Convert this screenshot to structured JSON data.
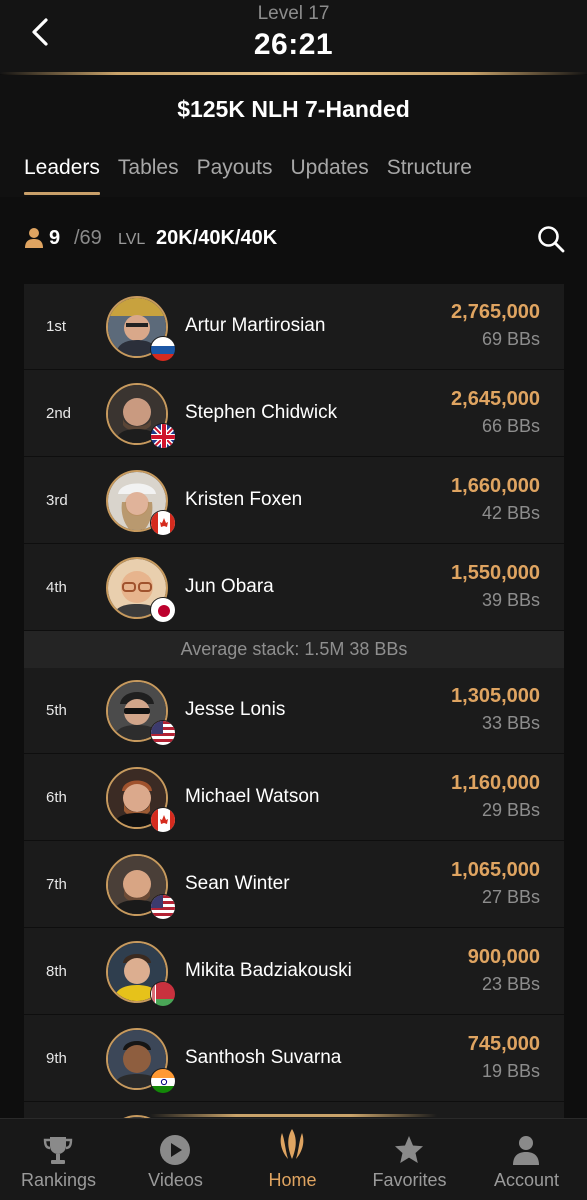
{
  "header": {
    "level_label": "Level 17",
    "clock": "26:21",
    "event_title": "$125K NLH 7-Handed"
  },
  "tabs": [
    {
      "label": "Leaders",
      "active": true
    },
    {
      "label": "Tables",
      "active": false
    },
    {
      "label": "Payouts",
      "active": false
    },
    {
      "label": "Updates",
      "active": false
    },
    {
      "label": "Structure",
      "active": false
    }
  ],
  "stats": {
    "players_left": "9",
    "players_total": "/69",
    "lvl_tag": "LVL",
    "blinds": "20K/40K/40K"
  },
  "leaders": [
    {
      "rank": "1st",
      "name": "Artur Martirosian",
      "chips": "2,765,000",
      "bbs": "69 BBs",
      "flag": "russia-flag-icon"
    },
    {
      "rank": "2nd",
      "name": "Stephen Chidwick",
      "chips": "2,645,000",
      "bbs": "66 BBs",
      "flag": "uk-flag-icon"
    },
    {
      "rank": "3rd",
      "name": "Kristen Foxen",
      "chips": "1,660,000",
      "bbs": "42 BBs",
      "flag": "canada-flag-icon"
    },
    {
      "rank": "4th",
      "name": "Jun Obara",
      "chips": "1,550,000",
      "bbs": "39 BBs",
      "flag": "japan-flag-icon"
    },
    {
      "rank": "5th",
      "name": "Jesse Lonis",
      "chips": "1,305,000",
      "bbs": "33 BBs",
      "flag": "usa-flag-icon"
    },
    {
      "rank": "6th",
      "name": "Michael Watson",
      "chips": "1,160,000",
      "bbs": "29 BBs",
      "flag": "canada-flag-icon"
    },
    {
      "rank": "7th",
      "name": "Sean Winter",
      "chips": "1,065,000",
      "bbs": "27 BBs",
      "flag": "usa-flag-icon"
    },
    {
      "rank": "8th",
      "name": "Mikita Badziakouski",
      "chips": "900,000",
      "bbs": "23 BBs",
      "flag": "belarus-flag-icon"
    },
    {
      "rank": "9th",
      "name": "Santhosh Suvarna",
      "chips": "745,000",
      "bbs": "19 BBs",
      "flag": "india-flag-icon"
    }
  ],
  "average_stack": "Average stack: 1.5M 38 BBs",
  "nav": [
    {
      "label": "Rankings",
      "icon": "trophy-icon",
      "active": false
    },
    {
      "label": "Videos",
      "icon": "play-icon",
      "active": false
    },
    {
      "label": "Home",
      "icon": "triton-logo-icon",
      "active": true
    },
    {
      "label": "Favorites",
      "icon": "star-icon",
      "active": false
    },
    {
      "label": "Account",
      "icon": "person-icon",
      "active": false
    }
  ],
  "colors": {
    "accent_gold": "#dfa461",
    "background": "#0e0e0e",
    "card": "#1b1b1b"
  }
}
